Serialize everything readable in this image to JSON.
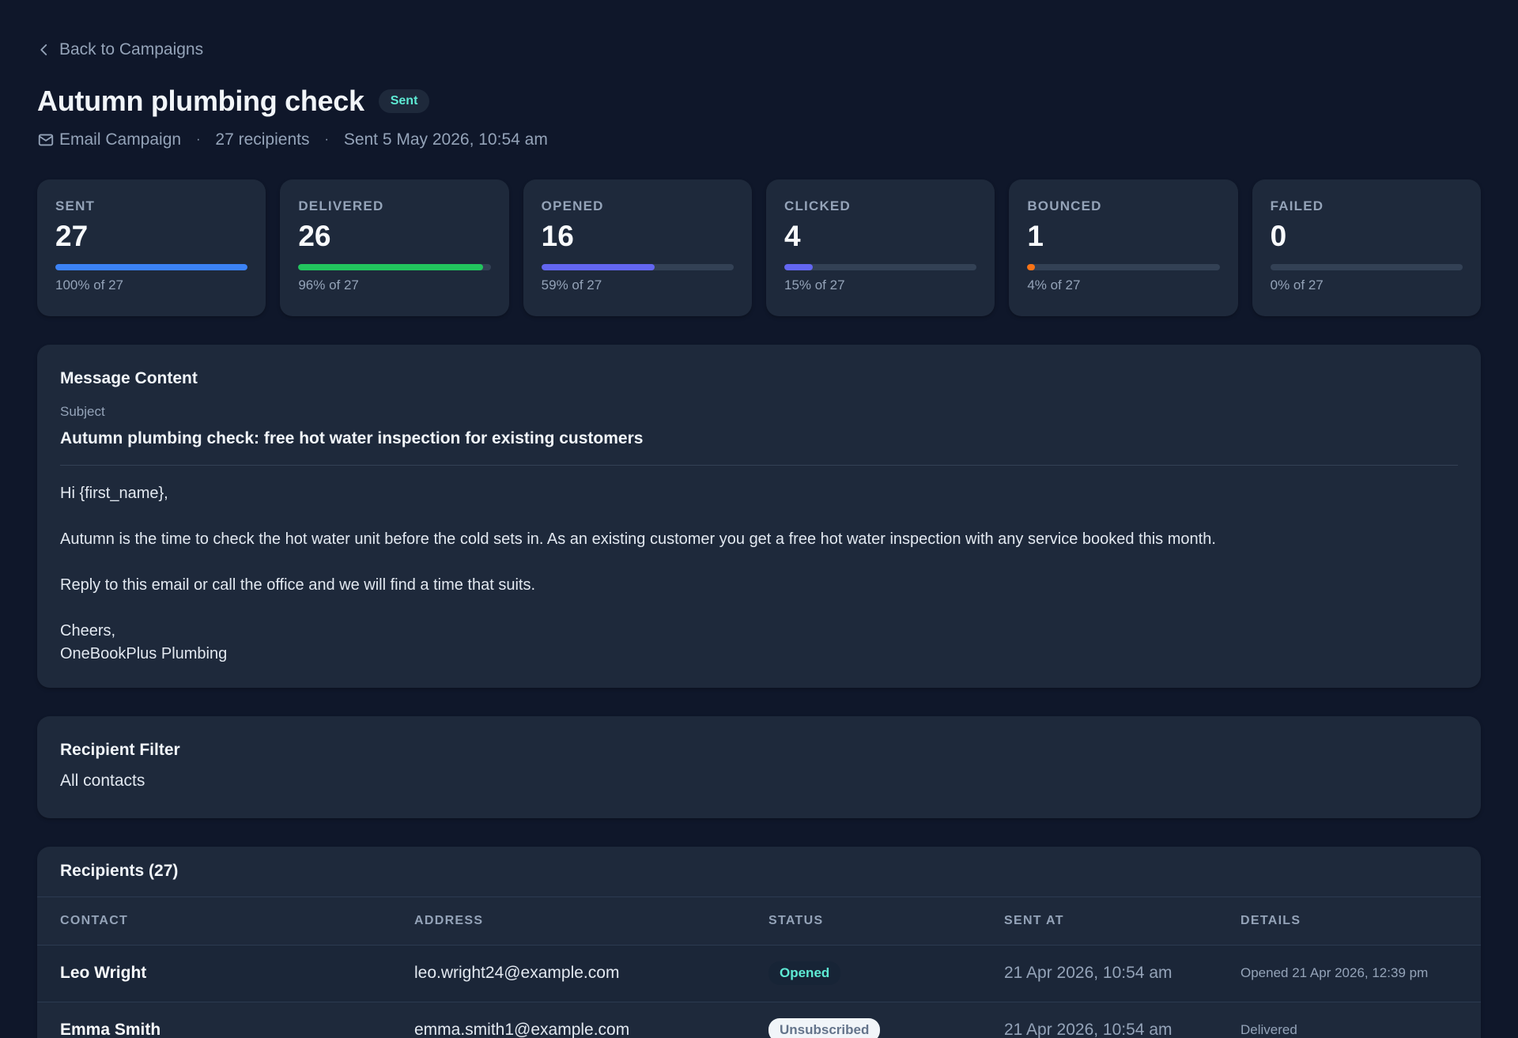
{
  "nav": {
    "back_label": "Back to Campaigns"
  },
  "header": {
    "title": "Autumn plumbing check",
    "status_badge": "Sent",
    "type": "Email Campaign",
    "recipients": "27 recipients",
    "sent_date": "Sent 5 May 2026, 10:54 am",
    "separator": "·"
  },
  "stats": [
    {
      "label": "SENT",
      "value": "27",
      "sub": "100% of 27",
      "fraction": 1.0,
      "color": "#3b82f6"
    },
    {
      "label": "DELIVERED",
      "value": "26",
      "sub": "96% of 27",
      "fraction": 0.96,
      "color": "#22c55e"
    },
    {
      "label": "OPENED",
      "value": "16",
      "sub": "59% of 27",
      "fraction": 0.59,
      "color": "#6366f1"
    },
    {
      "label": "CLICKED",
      "value": "4",
      "sub": "15% of 27",
      "fraction": 0.15,
      "color": "#6366f1"
    },
    {
      "label": "BOUNCED",
      "value": "1",
      "sub": "4% of 27",
      "fraction": 0.04,
      "color": "#f97316"
    },
    {
      "label": "FAILED",
      "value": "0",
      "sub": "0% of 27",
      "fraction": 0.0,
      "color": "#ef4444"
    }
  ],
  "message": {
    "title": "Message Content",
    "subject_label": "Subject",
    "subject": "Autumn plumbing check: free hot water inspection for existing customers",
    "greeting": "Hi {first_name},",
    "para1": "Autumn is the time to check the hot water unit before the cold sets in. As an existing customer you get a free hot water inspection with any service booked this month.",
    "para2": "Reply to this email or call the office and we will find a time that suits.",
    "signoff": "Cheers,",
    "signature": "OneBookPlus Plumbing"
  },
  "filter": {
    "title": "Recipient Filter",
    "value": "All contacts"
  },
  "recipients": {
    "title": "Recipients (27)",
    "columns": {
      "contact": "CONTACT",
      "address": "ADDRESS",
      "status": "STATUS",
      "sent_at": "SENT AT",
      "details": "DETAILS"
    },
    "rows": [
      {
        "contact": "Leo Wright",
        "address": "leo.wright24@example.com",
        "status": "Opened",
        "sent_at": "21 Apr 2026, 10:54 am",
        "details": "Opened 21 Apr 2026, 12:39 pm"
      },
      {
        "contact": "Emma Smith",
        "address": "emma.smith1@example.com",
        "status": "Unsubscribed",
        "sent_at": "21 Apr 2026, 10:54 am",
        "details": "Delivered"
      }
    ]
  },
  "icons": {
    "back": "chevron-left-icon",
    "type": "mail-icon"
  },
  "colors": {
    "background": "#0f172a",
    "card": "#1e293b",
    "accent_teal": "#5eead4"
  }
}
